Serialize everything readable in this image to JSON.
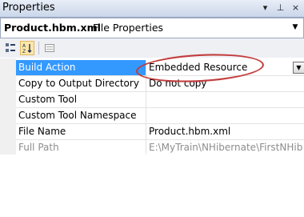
{
  "window": {
    "title": "Properties",
    "controls": [
      "▾",
      "⊥",
      "×"
    ]
  },
  "object_selector": {
    "name": "Product.hbm.xml",
    "type": "File Properties"
  },
  "toolbar": {
    "buttons": [
      "categorized-icon",
      "alphabetical-icon",
      "property-pages-icon"
    ]
  },
  "properties": [
    {
      "name": "Build Action",
      "value": "Embedded Resource",
      "selected": true
    },
    {
      "name": "Copy to Output Directory",
      "value": "Do not copy"
    },
    {
      "name": "Custom Tool",
      "value": ""
    },
    {
      "name": "Custom Tool Namespace",
      "value": ""
    },
    {
      "name": "File Name",
      "value": "Product.hbm.xml"
    },
    {
      "name": "Full Path",
      "value": "E:\\MyTrain\\NHibernate\\FirstNHib",
      "disabled": true
    }
  ],
  "annotation_color": "#c23b3b"
}
